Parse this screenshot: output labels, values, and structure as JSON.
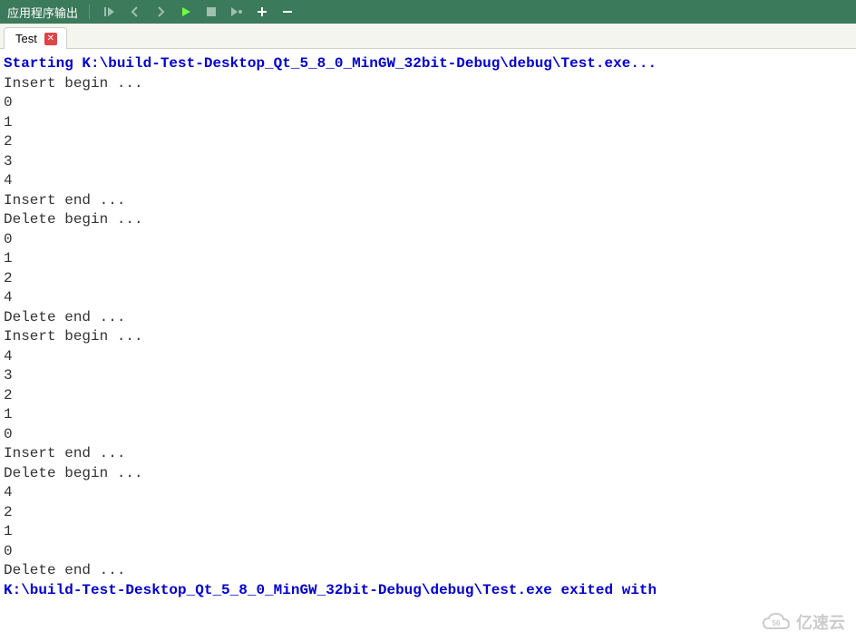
{
  "titlebar": {
    "text": "应用程序输出"
  },
  "tab": {
    "label": "Test"
  },
  "output": {
    "start_line": "Starting K:\\build-Test-Desktop_Qt_5_8_0_MinGW_32bit-Debug\\debug\\Test.exe...",
    "lines": [
      "Insert begin ...",
      "0",
      "1",
      "2",
      "3",
      "4",
      "Insert end ...",
      "Delete begin ...",
      "0",
      "1",
      "2",
      "4",
      "Delete end ...",
      "Insert begin ...",
      "4",
      "3",
      "2",
      "1",
      "0",
      "Insert end ...",
      "Delete begin ...",
      "4",
      "2",
      "1",
      "0",
      "Delete end ..."
    ],
    "exit_line": "K:\\build-Test-Desktop_Qt_5_8_0_MinGW_32bit-Debug\\debug\\Test.exe exited with"
  },
  "watermark": {
    "text": "亿速云"
  }
}
